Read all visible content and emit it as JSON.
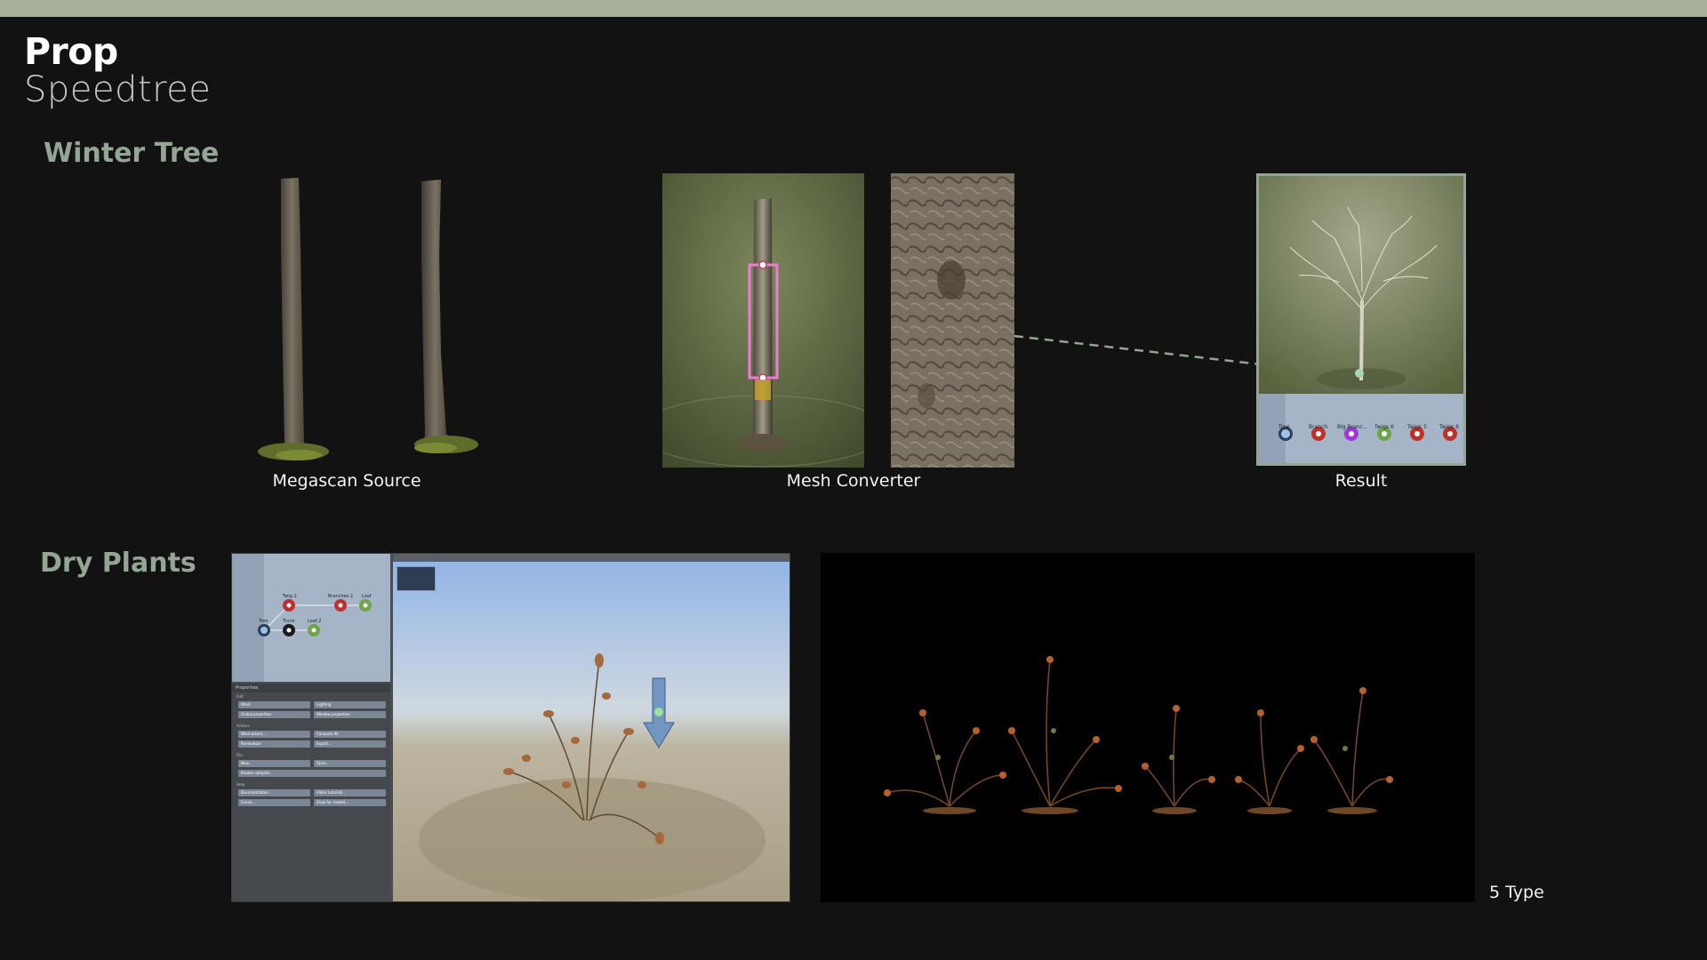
{
  "header": {
    "title": "Prop",
    "subtitle": "Speedtree"
  },
  "sections": {
    "winter_tree": {
      "title": "Winter Tree",
      "captions": {
        "source": "Megascan Source",
        "converter": "Mesh Converter",
        "result": "Result"
      },
      "result_nodes": [
        "Tree",
        "Branch",
        "Big Branc...",
        "Twigs 6",
        "Twigs 5",
        "Twigs 6"
      ]
    },
    "dry_plants": {
      "title": "Dry Plants",
      "editor_nodes": [
        "Twig 2",
        "Branches 2",
        "Leaf",
        "Tree",
        "Trunk",
        "Leaf 2"
      ],
      "editor_properties_title": "Properties",
      "editor_buttons": [
        [
          "Wind",
          "Lighting"
        ],
        [
          "Global properties",
          "Window properties"
        ],
        [
          "Wind wizard...",
          "Compute All"
        ],
        [
          "Randomize",
          "Export..."
        ],
        [
          "New...",
          "Open..."
        ],
        [
          "Browse samples..."
        ],
        [
          "Documentation...",
          "Video tutorials..."
        ],
        [
          "Forum...",
          "Shop for models..."
        ]
      ],
      "editor_sections": [
        "Edit",
        "Actions",
        "File",
        "Help"
      ],
      "count_label": "5 Type"
    }
  },
  "colors": {
    "background": "#121212",
    "top_bar": "#a9b09a",
    "section_title": "#93a593",
    "result_frame": "#93a593",
    "connector_line": "#93a593"
  }
}
